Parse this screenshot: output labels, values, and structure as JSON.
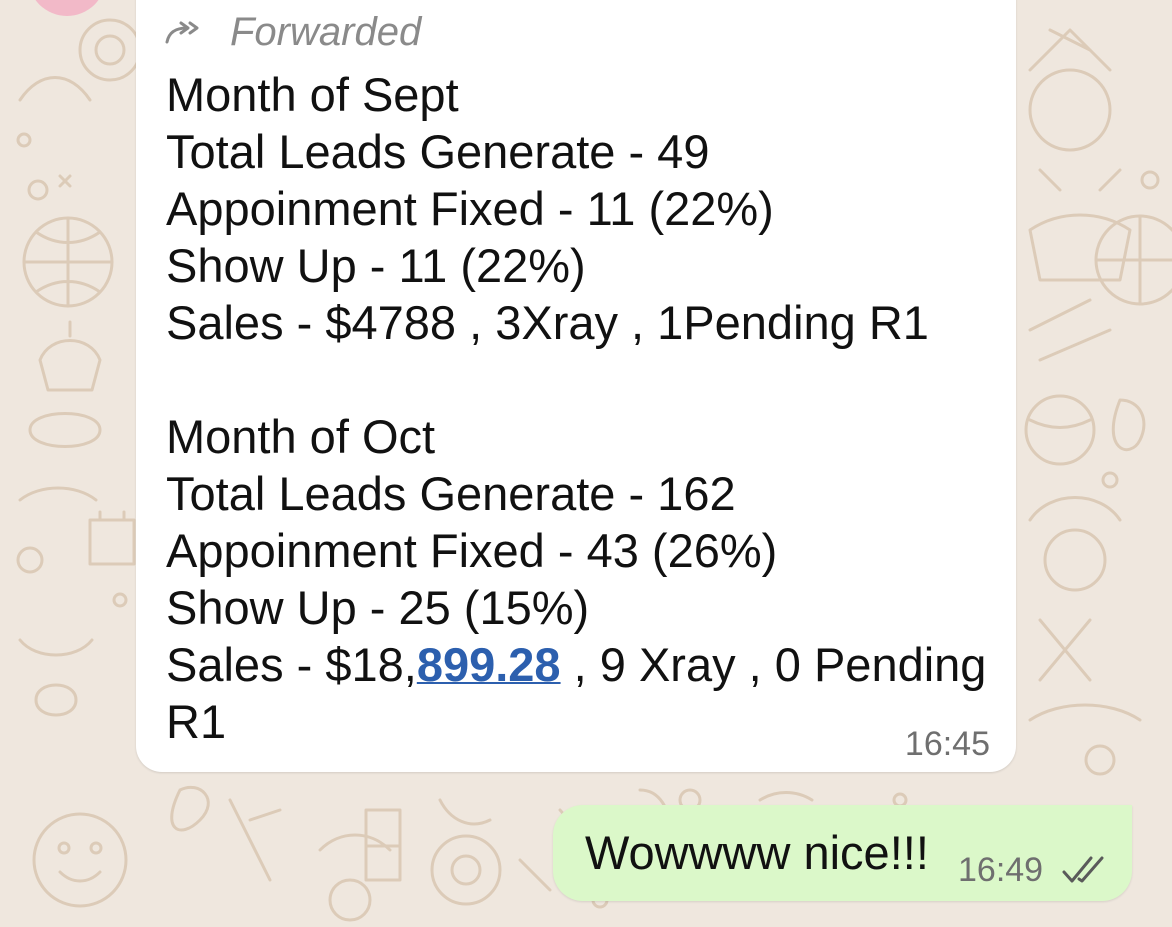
{
  "incoming_message": {
    "forwarded_label": "Forwarded",
    "forward_icon": "forward-arrow-icon",
    "lines": [
      "Month of Sept",
      "Total Leads Generate - 49",
      "Appoinment Fixed - 11 (22%)",
      "Show Up - 11 (22%)",
      "Sales - $4788 , 3Xray , 1Pending R1",
      "",
      "Month of Oct",
      "Total Leads Generate - 162",
      "Appoinment Fixed - 43 (26%)",
      "Show Up - 25 (15%)"
    ],
    "last_line_prefix": "Sales - $18,",
    "last_line_link": "899.28",
    "last_line_suffix": " , 9 Xray , 0 Pending",
    "last_line_wrap": "R1",
    "time": "16:45"
  },
  "outgoing_message": {
    "text": "Wowwww nice!!!",
    "time": "16:49",
    "status_icon": "double-check-read-icon"
  },
  "colors": {
    "chat_background": "#efe7de",
    "incoming_bubble": "#ffffff",
    "outgoing_bubble": "#dbf8c9",
    "link": "#2c5fae",
    "meta_text": "#6f6f6f",
    "wallpaper_doodle": "#dccbb8"
  }
}
